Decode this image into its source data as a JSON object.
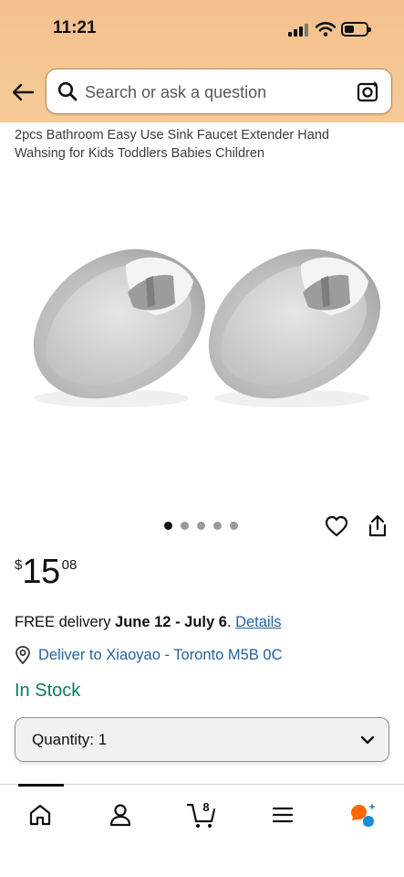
{
  "status_bar": {
    "time": "11:21"
  },
  "search": {
    "placeholder": "Search or ask a question"
  },
  "product": {
    "title": "2pcs Bathroom Easy Use Sink Faucet Extender Hand Wahsing for Kids Toddlers Babies Children",
    "image_count": 5,
    "active_image_index": 0,
    "price": {
      "symbol": "$",
      "whole": "15",
      "fraction": "08"
    },
    "delivery": {
      "prefix": "FREE delivery ",
      "dates": "June 12 - July 6",
      "suffix": ". ",
      "details_link": "Details"
    },
    "deliver_to": "Deliver to Xiaoyao - Toronto M5B 0C",
    "availability": "In Stock",
    "quantity_label": "Quantity: 1"
  },
  "tabbar": {
    "items": [
      "home-icon",
      "account-icon",
      "cart-icon",
      "menu-icon",
      "rufus-icon"
    ],
    "cart_count": "8"
  },
  "colors": {
    "header_bg": "#f6c591",
    "link": "#2162a1",
    "in_stock": "#067d62",
    "rufus_orange": "#ff6a00",
    "rufus_blue": "#1a8cd8"
  }
}
